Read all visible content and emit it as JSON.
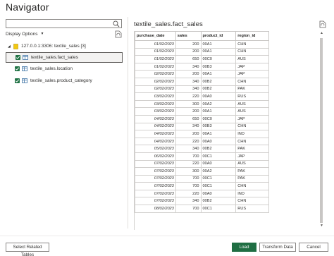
{
  "window": {
    "title": "Navigator"
  },
  "left": {
    "search": {
      "value": "",
      "placeholder": ""
    },
    "display_options": "Display Options",
    "server": "127.0.0.1:3306: textile_sales [3]",
    "tables": [
      {
        "label": "textile_sales.fact_sales",
        "checked": true,
        "selected": true
      },
      {
        "label": "textile_sales.location",
        "checked": true,
        "selected": false
      },
      {
        "label": "textile_sales.product_category",
        "checked": true,
        "selected": false
      }
    ]
  },
  "preview": {
    "title": "textile_sales.fact_sales",
    "columns": [
      "purchase_date",
      "sales",
      "product_id",
      "region_id"
    ],
    "rows": [
      [
        "01/02/2023",
        "200",
        "00A1",
        "CHN"
      ],
      [
        "01/02/2023",
        "200",
        "00A1",
        "CHN"
      ],
      [
        "01/02/2023",
        "650",
        "00C0",
        "AUS"
      ],
      [
        "01/02/2023",
        "340",
        "00B3",
        "JAP"
      ],
      [
        "02/02/2023",
        "200",
        "00A1",
        "JAP"
      ],
      [
        "02/02/2023",
        "340",
        "00B2",
        "CHN"
      ],
      [
        "02/02/2023",
        "340",
        "00B2",
        "PAK"
      ],
      [
        "03/02/2023",
        "220",
        "00A0",
        "RUS"
      ],
      [
        "03/02/2023",
        "300",
        "00A2",
        "AUS"
      ],
      [
        "03/02/2023",
        "200",
        "00A1",
        "AUS"
      ],
      [
        "04/02/2023",
        "650",
        "00C0",
        "JAP"
      ],
      [
        "04/02/2023",
        "340",
        "00B3",
        "CHN"
      ],
      [
        "04/02/2023",
        "200",
        "00A1",
        "IND"
      ],
      [
        "04/02/2023",
        "220",
        "00A0",
        "CHN"
      ],
      [
        "05/02/2023",
        "340",
        "00B2",
        "PAK"
      ],
      [
        "06/02/2023",
        "700",
        "00C1",
        "JAP"
      ],
      [
        "07/02/2023",
        "220",
        "00A0",
        "AUS"
      ],
      [
        "07/02/2023",
        "300",
        "00A2",
        "PAK"
      ],
      [
        "07/02/2023",
        "700",
        "00C1",
        "PAK"
      ],
      [
        "07/02/2023",
        "700",
        "00C1",
        "CHN"
      ],
      [
        "07/02/2023",
        "220",
        "00A0",
        "IND"
      ],
      [
        "07/02/2023",
        "340",
        "00B2",
        "CHN"
      ],
      [
        "08/02/2023",
        "700",
        "00C1",
        "RUS"
      ]
    ]
  },
  "buttons": {
    "select_related": "Select Related Tables",
    "load": "Load",
    "transform": "Transform Data",
    "cancel": "Cancel"
  },
  "colors": {
    "load_button": "#1f6e43",
    "checkbox": "#217346"
  }
}
